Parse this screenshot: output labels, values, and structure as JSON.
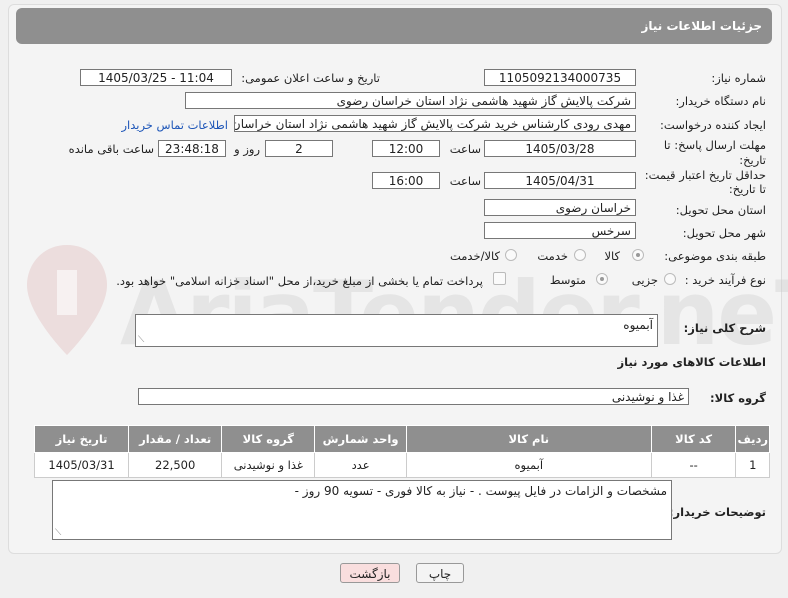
{
  "header": {
    "title": "جزئیات اطلاعات نیاز"
  },
  "form": {
    "need_number_label": "شماره نیاز:",
    "need_number": "1105092134000735",
    "announce_label": "تاریخ و ساعت اعلان عمومی:",
    "announce_value": "1405/03/25 - 11:04",
    "buyer_label": "نام دستگاه خریدار:",
    "buyer_value": "شرکت پالایش گاز شهید هاشمی نژاد   استان خراسان رضوی",
    "creator_label": "ایجاد کننده درخواست:",
    "creator_value": "مهدی رودی کارشناس خرید شرکت پالایش گاز شهید هاشمی نژاد   استان خراسان رضوی",
    "contact_link": "اطلاعات تماس خریدار",
    "deadline_label_1": "مهلت ارسال پاسخ: تا",
    "deadline_label_2": "تاریخ:",
    "deadline_date": "1405/03/28",
    "time_label": "ساعت",
    "deadline_time": "12:00",
    "days_value": "2",
    "days_label": "روز و",
    "remaining_time": "23:48:18",
    "remaining_label": "ساعت باقی مانده",
    "validity_label_1": "حداقل تاریخ اعتبار قیمت:",
    "validity_label_2": "تا تاریخ:",
    "validity_date": "1405/04/31",
    "validity_time": "16:00",
    "province_label": "استان محل تحویل:",
    "province_value": "خراسان رضوی",
    "city_label": "شهر محل تحویل:",
    "city_value": "سرخس",
    "category_label": "طبقه بندی موضوعی:",
    "category_options": [
      "کالا",
      "خدمت",
      "کالا/خدمت"
    ],
    "category_selected": "کالا",
    "process_label": "نوع فرآیند خرید :",
    "process_options": [
      "جزیی",
      "متوسط"
    ],
    "process_selected": "متوسط",
    "payment_note": "پرداخت تمام یا بخشی از مبلغ خرید،از محل \"اسناد خزانه اسلامی\" خواهد بود."
  },
  "description": {
    "label": "شرح کلی نیاز:",
    "value": "آبمیوه"
  },
  "goods": {
    "section_title": "اطلاعات کالاهای مورد نیاز",
    "group_label": "گروه کالا:",
    "group_value": "غذا و نوشیدنی",
    "columns": [
      "ردیف",
      "کد کالا",
      "نام کالا",
      "واحد شمارش",
      "گروه کالا",
      "تعداد / مقدار",
      "تاریخ نیاز"
    ],
    "rows": [
      [
        "1",
        "--",
        "آبمیوه",
        "عدد",
        "غذا و نوشیدنی",
        "22,500",
        "1405/03/31"
      ]
    ]
  },
  "buyer_notes": {
    "label": "توضیحات خریدار:",
    "value": "مشخصات و الزامات در فایل پیوست .  -  نیاز به کالا فوری  - تسویه 90 روز -"
  },
  "buttons": {
    "print": "چاپ",
    "back": "بازگشت"
  },
  "colors": {
    "header_bg": "#8f8f8f",
    "link": "#1e56b8",
    "back_button_bg": "#f9dede"
  }
}
